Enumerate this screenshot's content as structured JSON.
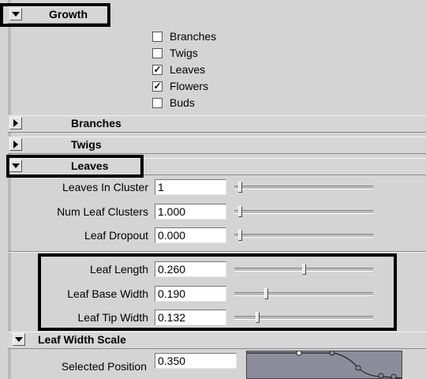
{
  "growth": {
    "title": "Growth",
    "options": [
      {
        "label": "Branches",
        "checked": false
      },
      {
        "label": "Twigs",
        "checked": false
      },
      {
        "label": "Leaves",
        "checked": true
      },
      {
        "label": "Flowers",
        "checked": true
      },
      {
        "label": "Buds",
        "checked": false
      }
    ]
  },
  "sections": {
    "branches": {
      "title": "Branches"
    },
    "twigs": {
      "title": "Twigs"
    },
    "leaves": {
      "title": "Leaves"
    },
    "leaf_width_scale": {
      "title": "Leaf Width Scale"
    }
  },
  "leaves_fields": [
    {
      "label": "Leaves In Cluster",
      "value": "1",
      "slider_fraction": 0.03
    },
    {
      "label": "Num Leaf Clusters",
      "value": "1.000",
      "slider_fraction": 0.03
    },
    {
      "label": "Leaf Dropout",
      "value": "0.000",
      "slider_fraction": 0.03
    },
    {
      "label": "Leaf Length",
      "value": "0.260",
      "slider_fraction": 0.5
    },
    {
      "label": "Leaf Base Width",
      "value": "0.190",
      "slider_fraction": 0.22
    },
    {
      "label": "Leaf Tip Width",
      "value": "0.132",
      "slider_fraction": 0.16
    }
  ],
  "selected_position": {
    "label": "Selected Position",
    "value": "0.350"
  },
  "colors": {
    "panel_bg": "#d4d4d4",
    "highlight": "#000000",
    "graph_bg": "#8c8c9c"
  }
}
